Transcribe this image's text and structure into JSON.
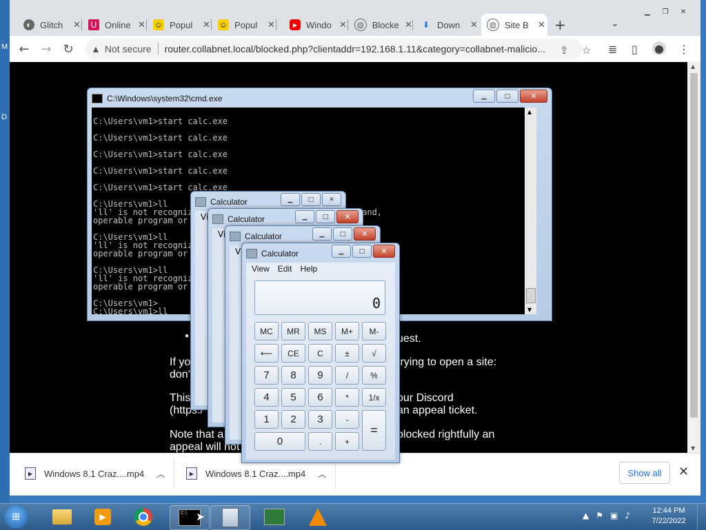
{
  "browser": {
    "tabs": [
      {
        "title": "Glitch",
        "icon": "glitch-icon"
      },
      {
        "title": "Online",
        "icon": "online-icon"
      },
      {
        "title": "Popul",
        "icon": "smiley-icon"
      },
      {
        "title": "Popul",
        "icon": "smiley-icon"
      },
      {
        "title": "Windo",
        "icon": "youtube-icon"
      },
      {
        "title": "Blocke",
        "icon": "globe-icon"
      },
      {
        "title": "Down",
        "icon": "download-icon"
      },
      {
        "title": "Site B",
        "icon": "globe-icon",
        "active": true
      }
    ],
    "new_tab": "+",
    "security_label": "Not secure",
    "url": "router.collabnet.local/blocked.php?clientaddr=192.168.1.11&category=collabnet-malicio..."
  },
  "page": {
    "bullet_fragment": "uest.",
    "para1_line1_left": "If yo",
    "para1_line1_right": "trying to open a site:",
    "para1_line2_left": "don'",
    "para2_line1_left": "This",
    "para2_line1_right": "our Discord",
    "para2_line2_left": "(https:/",
    "para2_line2_right": "an appeal ticket.",
    "para3_line1_left": "Note that a",
    "para3_line1_right": "blocked rightfully an",
    "para3_line2_left": "appeal will not"
  },
  "cmd": {
    "title": "C:\\Windows\\system32\\cmd.exe",
    "lines": [
      "",
      "C:\\Users\\vm1>start calc.exe",
      "",
      "C:\\Users\\vm1>start calc.exe",
      "",
      "C:\\Users\\vm1>start calc.exe",
      "",
      "C:\\Users\\vm1>start calc.exe",
      "",
      "C:\\Users\\vm1>start calc.exe",
      "",
      "C:\\Users\\vm1>ll",
      "'ll' is not recognized as an internal or external command,",
      "operable program or batch file.",
      "",
      "C:\\Users\\vm1>ll",
      "'ll' is not recognized as an internal or external command,",
      "operable program or batch file.",
      "",
      "C:\\Users\\vm1>ll",
      "'ll' is not recognized as an internal or external command,",
      "operable program or batch file.",
      "",
      "C:\\Users\\vm1>",
      "C:\\Users\\vm1>ll"
    ]
  },
  "calculator": {
    "title": "Calculator",
    "menu": [
      "View",
      "Edit",
      "Help"
    ],
    "ghost_menu_fragment": "Vi",
    "display": "0",
    "memory_buttons": [
      "MC",
      "MR",
      "MS",
      "M+",
      "M-"
    ],
    "row2": [
      "⟵",
      "CE",
      "C",
      "±",
      "√"
    ],
    "row3": [
      "7",
      "8",
      "9",
      "/",
      "%"
    ],
    "row4": [
      "4",
      "5",
      "6",
      "*",
      "1/x"
    ],
    "row5": [
      "1",
      "2",
      "3",
      "-"
    ],
    "zero": "0",
    "dot": ".",
    "plus": "+",
    "equals": "="
  },
  "downloads": {
    "items": [
      "Windows 8.1 Craz....mp4",
      "Windows 8.1 Craz....mp4"
    ],
    "show_all": "Show all"
  },
  "taskbar": {
    "time": "12:44 PM",
    "date": "7/22/2022",
    "apps": [
      "explorer-icon",
      "media-player-icon",
      "chrome-icon",
      "cmd-icon",
      "calculator-icon",
      "network-app-icon",
      "vlc-icon"
    ]
  }
}
